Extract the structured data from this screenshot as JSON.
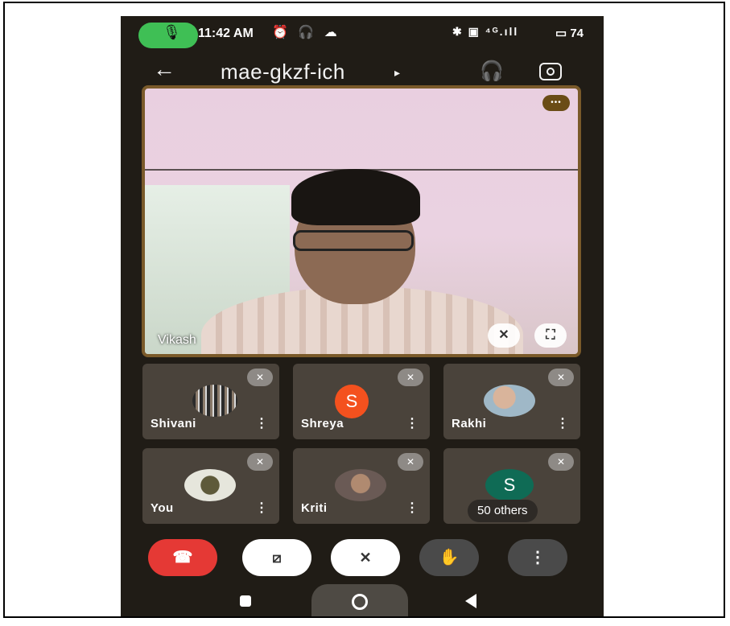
{
  "status_bar": {
    "mic_glyph": "🎙",
    "time": "11:42 AM",
    "left_icons": "⏰ 🎧 ☁",
    "right_icons": "✱ ▣ ⁴ᴳ.ıll",
    "battery": "▭ 74"
  },
  "header": {
    "back_icon": "←",
    "meeting_code": "mae-gkzf-ich",
    "caret": "▸",
    "headset_icon": "🎧"
  },
  "main_video": {
    "participant": "Vikash",
    "badge": "•••",
    "unpin_icon": "✕",
    "fullscreen_icon": "⛶"
  },
  "tiles": [
    {
      "name": "Shivani",
      "initial": "",
      "avatar_color": "#3a3a3a",
      "more": "⋮",
      "mute": "✕"
    },
    {
      "name": "Shreya",
      "initial": "S",
      "avatar_color": "#f4511e",
      "more": "⋮",
      "mute": "✕"
    },
    {
      "name": "Rakhi",
      "initial": "",
      "avatar_color": "#c9d3d8",
      "more": "⋮",
      "mute": "✕"
    },
    {
      "name": "You",
      "initial": "",
      "avatar_color": "#bfbfae",
      "more": "⋮",
      "mute": "✕"
    },
    {
      "name": "Kriti",
      "initial": "",
      "avatar_color": "#b89d8c",
      "more": "⋮",
      "mute": "✕"
    },
    {
      "name": "50 others",
      "initial": "S",
      "avatar_color": "#0f6b55",
      "more": "",
      "mute": "✕"
    }
  ],
  "controls": {
    "end_call": "☎",
    "camera": "⧄",
    "mic": "✕",
    "raise_hand": "✋",
    "more": "⋮"
  }
}
